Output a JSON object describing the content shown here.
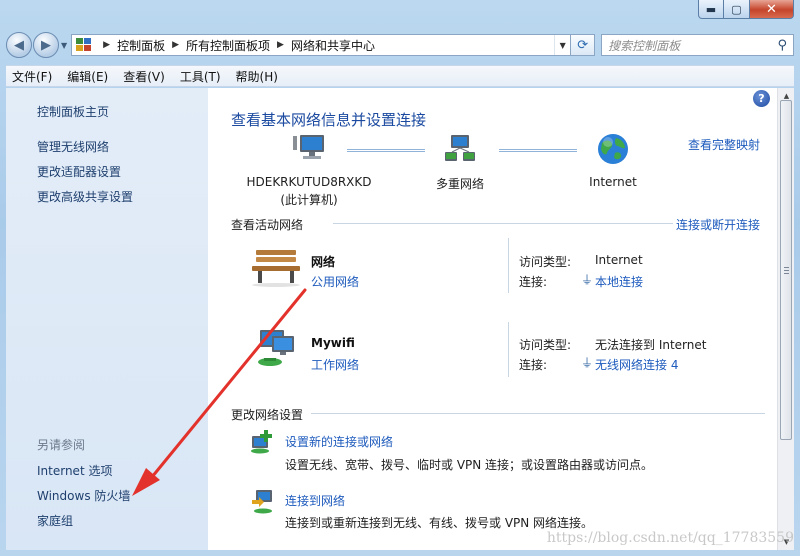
{
  "window": {
    "caption_buttons": {
      "minimize": "▬",
      "maximize": "▢",
      "close": "✕"
    }
  },
  "navbar": {
    "back_icon": "back-arrow-icon",
    "forward_icon": "forward-arrow-icon",
    "breadcrumbs": [
      "控制面板",
      "所有控制面板项",
      "网络和共享中心"
    ],
    "search_placeholder": "搜索控制面板"
  },
  "menu": [
    "文件(F)",
    "编辑(E)",
    "查看(V)",
    "工具(T)",
    "帮助(H)"
  ],
  "sidebar": {
    "home": "控制面板主页",
    "links": [
      "管理无线网络",
      "更改适配器设置",
      "更改高级共享设置"
    ],
    "see_also_heading": "另请参阅",
    "see_also": [
      "Internet 选项",
      "Windows 防火墙",
      "家庭组"
    ]
  },
  "main": {
    "title": "查看基本网络信息并设置连接",
    "full_map_link": "查看完整映射",
    "map": {
      "computer_name": "HDEKRKUTUD8RXKD",
      "computer_sub": "(此计算机)",
      "middle": "多重网络",
      "end": "Internet"
    },
    "active_header": "查看活动网络",
    "connect_link": "连接或断开连接",
    "networks": [
      {
        "name": "网络",
        "type_link": "公用网络",
        "access_label": "访问类型:",
        "access_value": "Internet",
        "conn_label": "连接:",
        "conn_value": "本地连接"
      },
      {
        "name": "Mywifi",
        "type_link": "工作网络",
        "access_label": "访问类型:",
        "access_value": "无法连接到 Internet",
        "conn_label": "连接:",
        "conn_value": "无线网络连接 4"
      }
    ],
    "change_header": "更改网络设置",
    "tasks": [
      {
        "link": "设置新的连接或网络",
        "desc": "设置无线、宽带、拨号、临时或 VPN 连接；或设置路由器或访问点。"
      },
      {
        "link": "连接到网络",
        "desc": "连接到或重新连接到无线、有线、拨号或 VPN 网络连接。"
      }
    ]
  },
  "watermark": "https://blog.csdn.net/qq_17783559",
  "colors": {
    "link": "#1e5bbd",
    "title": "#1b4aa0",
    "arrow": "#e3322b",
    "sidebar_bg": "#dde8f6"
  }
}
